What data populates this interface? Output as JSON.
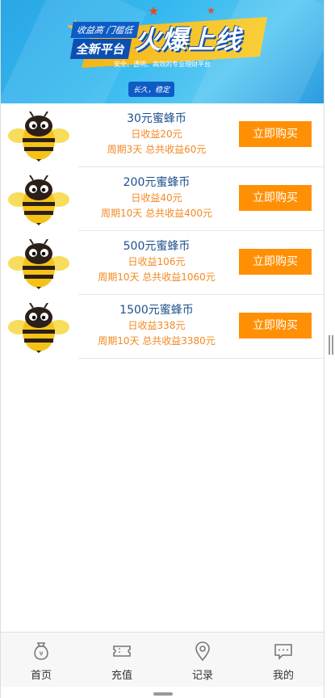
{
  "banner": {
    "tag": "收益高 门槛低",
    "subtitle": "全新平台",
    "headline": "火爆上线",
    "description": "安全、透明、高效的专业理财平台",
    "pill": "长久，稳定"
  },
  "products": [
    {
      "name": "30元蜜蜂币",
      "daily": "日收益20元",
      "period": "周期3天 总共收益60元",
      "button": "立即购买"
    },
    {
      "name": "200元蜜蜂币",
      "daily": "日收益40元",
      "period": "周期10天 总共收益400元",
      "button": "立即购买"
    },
    {
      "name": "500元蜜蜂币",
      "daily": "日收益106元",
      "period": "周期10天 总共收益1060元",
      "button": "立即购买"
    },
    {
      "name": "1500元蜜蜂币",
      "daily": "日收益338元",
      "period": "周期10天 总共收益3380元",
      "button": "立即购买"
    }
  ],
  "tabbar": {
    "tabs": [
      {
        "label": "首页",
        "icon": "money-bag-icon"
      },
      {
        "label": "充值",
        "icon": "ticket-icon"
      },
      {
        "label": "记录",
        "icon": "location-pin-icon"
      },
      {
        "label": "我的",
        "icon": "chat-bubble-icon"
      }
    ]
  },
  "colors": {
    "accent": "#ff9005",
    "name_text": "#1d4f8c",
    "income_text": "#f08a25",
    "banner_blue": "#2aa6e6"
  }
}
